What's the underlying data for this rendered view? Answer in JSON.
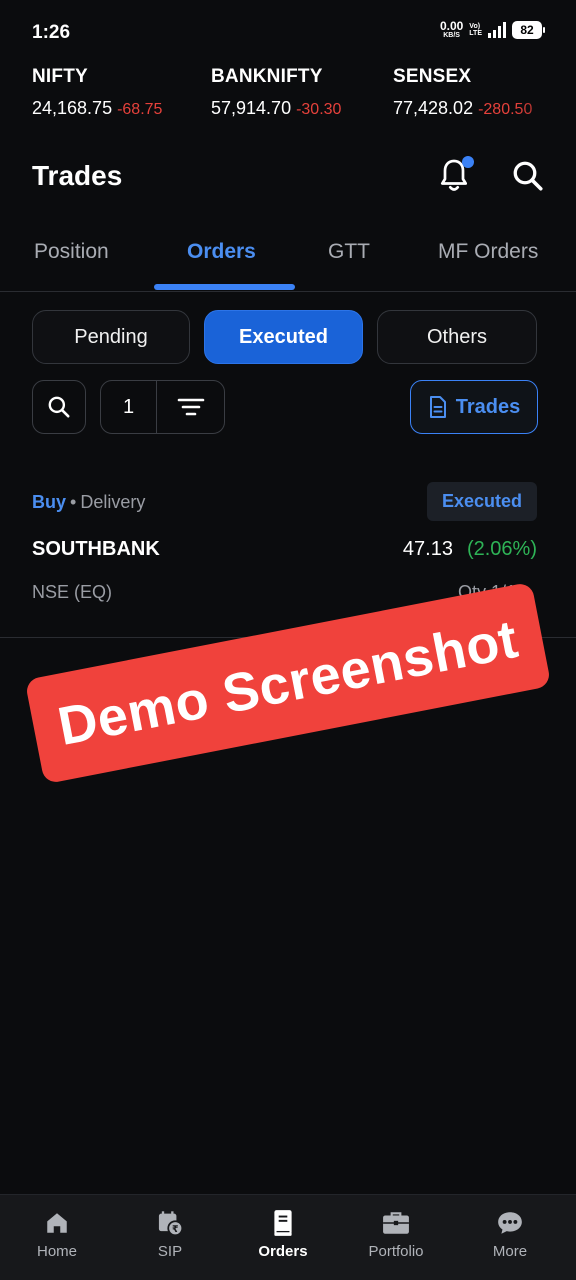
{
  "status_bar": {
    "time": "1:26",
    "net_speed": "0.00",
    "net_unit": "KB/S",
    "volte_top": "Vo)",
    "volte_bottom": "LTE",
    "battery": "82"
  },
  "indices": [
    {
      "name": "NIFTY",
      "value": "24,168.75",
      "change": "-68.75"
    },
    {
      "name": "BANKNIFTY",
      "value": "57,914.70",
      "change": "-30.30"
    },
    {
      "name": "SENSEX",
      "value": "77,428.02",
      "change": "-280.50"
    }
  ],
  "header": {
    "title": "Trades"
  },
  "tabs": [
    {
      "label": "Position"
    },
    {
      "label": "Orders"
    },
    {
      "label": "GTT"
    },
    {
      "label": "MF Orders"
    }
  ],
  "segments": [
    {
      "label": "Pending"
    },
    {
      "label": "Executed"
    },
    {
      "label": "Others"
    }
  ],
  "toolbar": {
    "filter_count": "1",
    "trades_label": "Trades"
  },
  "orders": [
    {
      "side": "Buy",
      "product": "Delivery",
      "status": "Executed",
      "symbol": "SOUTHBANK",
      "price": "47.13",
      "change_pct": "(2.06%)",
      "exchange": "NSE (EQ)",
      "qty": "Qty 1/1"
    }
  ],
  "watermark": "Demo Screenshot",
  "bottom_nav": [
    {
      "label": "Home",
      "icon": "home-icon"
    },
    {
      "label": "SIP",
      "icon": "sip-icon"
    },
    {
      "label": "Orders",
      "icon": "orders-book-icon"
    },
    {
      "label": "Portfolio",
      "icon": "briefcase-icon"
    },
    {
      "label": "More",
      "icon": "more-chat-icon"
    }
  ],
  "colors": {
    "background": "#0b0c0e",
    "accent": "#3b82f6",
    "negative": "#e5413b",
    "positive": "#2eb356",
    "watermark": "#f0423c"
  }
}
